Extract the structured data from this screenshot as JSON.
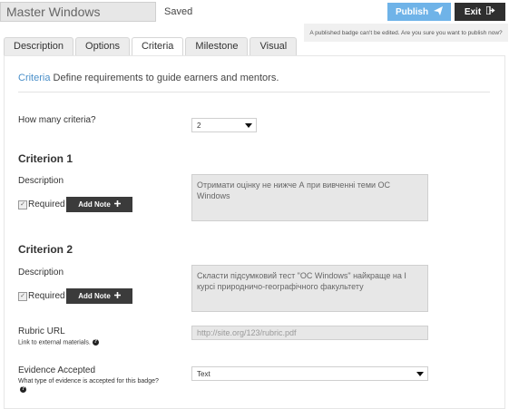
{
  "header": {
    "badge_title": "Master Windows",
    "save_status": "Saved",
    "publish_label": "Publish",
    "exit_label": "Exit",
    "publish_warning": "A published badge can't be edited. Are you sure you want to publish now?"
  },
  "tabs": [
    {
      "label": "Description"
    },
    {
      "label": "Options"
    },
    {
      "label": "Criteria"
    },
    {
      "label": "Milestone"
    },
    {
      "label": "Visual"
    }
  ],
  "intro": {
    "link": "Criteria",
    "text": "Define requirements to guide earners and mentors."
  },
  "criteria_count": {
    "label": "How many criteria?",
    "value": "2"
  },
  "criterion1": {
    "title": "Criterion 1",
    "description_label": "Description",
    "description": "Отримати оцінку не нижче А при вивченні теми ОС Windows",
    "required_label": "Required",
    "add_note_label": "Add Note"
  },
  "criterion2": {
    "title": "Criterion 2",
    "description_label": "Description",
    "description": "Скласти підсумковий тест \"ОС Windows\" найкраще на І курсі природничо-географічного факультету",
    "required_label": "Required",
    "add_note_label": "Add Note"
  },
  "rubric": {
    "label": "Rubric URL",
    "sub_label": "Link to external materials.",
    "placeholder": "http://site.org/123/rubric.pdf"
  },
  "evidence": {
    "label": "Evidence Accepted",
    "sub_label": "What type of evidence is accepted for this badge?",
    "value": "Text"
  }
}
